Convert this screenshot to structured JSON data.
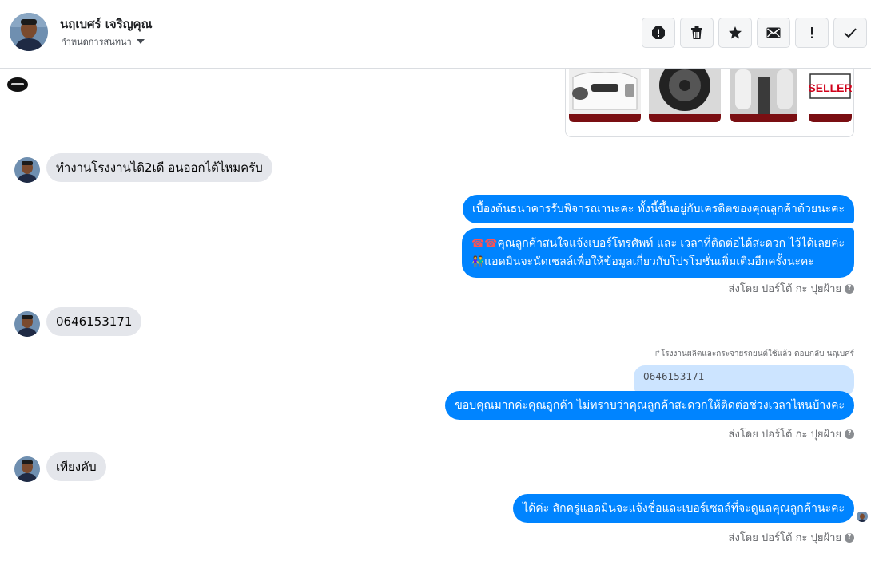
{
  "header": {
    "name": "นฤเบศร์ เจริญคุณ",
    "subtitle": "กำหนดการสนทนา",
    "toolbar_icons": [
      "spam-report-icon",
      "trash-icon",
      "star-icon",
      "envelope-icon",
      "exclamation-icon",
      "check-icon"
    ]
  },
  "top_image": {
    "badge_text": "SELLER"
  },
  "messages": {
    "in_1": "ทำงานโรงงานไดิ2เดื อนออกได้ไหมครับ",
    "out_1": "เบื้องต้นธนาคารรับพิจารณานะคะ ทั้งนี้ขึ้นอยู่กับเครดิตของคุณลูกค้าด้วยนะคะ",
    "out_2_line1": "คุณลูกค้าสนใจแจ้งเบอร์โทรศัพท์ และ เวลาที่ติดต่อได้สะดวก ไว้ได้เลยค่ะ",
    "out_2_line2": "แอดมินจะนัดเซลล์เพื่อให้ข้อมูลเกี่ยวกับโปรโมชั่นเพิ่มเติมอีกครั้งนะคะ",
    "out_2_emoji1": "☎☎",
    "out_2_emoji2": "👫",
    "sent_by_1": "ส่งโดย ปอร์โต้ กะ ปุยฝ้าย",
    "in_2": "0646153171",
    "reply_note": "โรงงานผลิตและกระจายรถยนต์ใช้แล้ว ตอบกลับ นฤเบศร์",
    "quoted": "0646153171",
    "out_3": "ขอบคุณมากค่ะคุณลูกค้า ไม่ทราบว่าคุณลูกค้าสะดวกให้ติดต่อช่วงเวลาไหนบ้างคะ",
    "sent_by_2": "ส่งโดย ปอร์โต้ กะ ปุยฝ้าย",
    "in_3": "เทียงคับ",
    "out_4": "ได้ค่ะ สักครู่แอดมินจะแจ้งชื่อและเบอร์เซลล์ที่จะดูแลคุณลูกค้านะคะ",
    "sent_by_3": "ส่งโดย ปอร์โต้ กะ ปุยฝ้าย",
    "help_glyph": "?"
  },
  "colors": {
    "outgoing_bubble": "#0084ff",
    "incoming_bubble": "#e4e6eb",
    "quoted_bubble": "#cce4ff"
  }
}
